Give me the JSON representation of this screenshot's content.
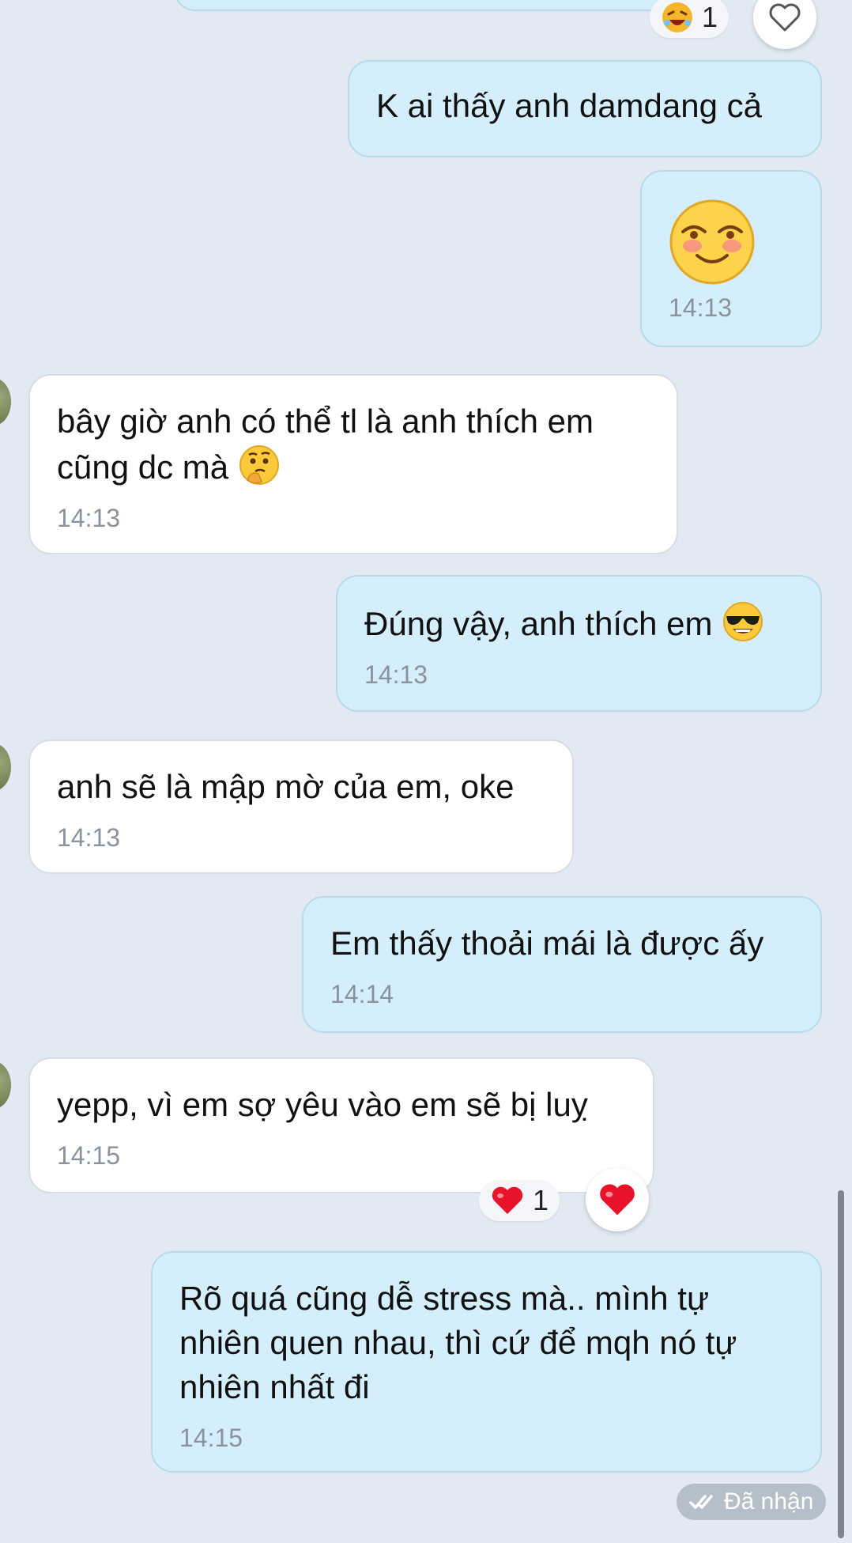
{
  "messages": [
    {
      "id": "m1",
      "side": "me",
      "text": "K ai thấy anh damdang cả"
    },
    {
      "id": "m2",
      "side": "me",
      "sticker": "blushing-smile-emoji",
      "time": "14:13"
    },
    {
      "id": "m3",
      "side": "them",
      "text": "bây giờ anh có thể tl là anh thích em cũng dc mà",
      "emoji": "thinking-face-emoji",
      "time": "14:13"
    },
    {
      "id": "m4",
      "side": "me",
      "text": "Đúng vậy, anh thích em",
      "emoji": "sunglasses-face-emoji",
      "time": "14:13"
    },
    {
      "id": "m5",
      "side": "them",
      "text": "anh sẽ là mập mờ của em, oke",
      "time": "14:13"
    },
    {
      "id": "m6",
      "side": "me",
      "text": "Em thấy thoải mái là được ấy",
      "time": "14:14"
    },
    {
      "id": "m7",
      "side": "them",
      "text": "yepp, vì em sợ yêu vào em sẽ bị luỵ",
      "time": "14:15",
      "reaction": {
        "emoji": "heart",
        "count": "1"
      }
    },
    {
      "id": "m8",
      "side": "me",
      "text": "Rõ quá cũng dễ stress mà.. mình tự nhiên quen nhau, thì cứ để mqh nó tự nhiên nhất đi",
      "time": "14:15"
    }
  ],
  "top_reaction": {
    "emoji": "laughing-face",
    "count": "1"
  },
  "status": {
    "label": "Đã nhận",
    "icon": "double-check-icon"
  },
  "colors": {
    "background": "#e2e9f2",
    "my_bubble": "#d4effb",
    "their_bubble": "#ffffff",
    "heart": "#e8132b"
  }
}
